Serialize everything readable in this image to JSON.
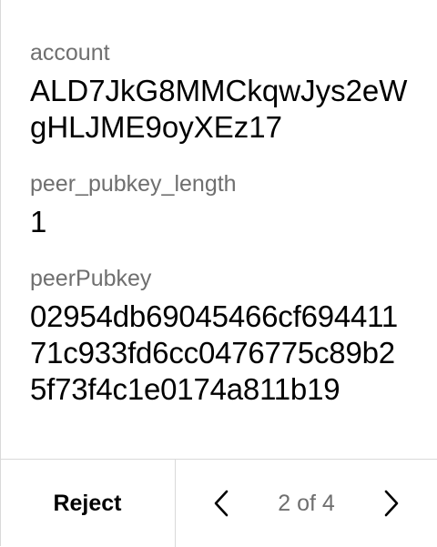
{
  "fields": [
    {
      "label": "account",
      "value": "ALD7JkG8MMCkqwJys2eWgHLJME9oyXEz17"
    },
    {
      "label": "peer_pubkey_length",
      "value": "1"
    },
    {
      "label": "peerPubkey",
      "value": "02954db69045466cf69441171c933fd6cc0476775c89b25f73f4c1e0174a811b19"
    }
  ],
  "footer": {
    "reject_label": "Reject",
    "page_indicator": "2 of 4",
    "prev_icon": "chevron-left-icon",
    "next_icon": "chevron-right-icon"
  }
}
